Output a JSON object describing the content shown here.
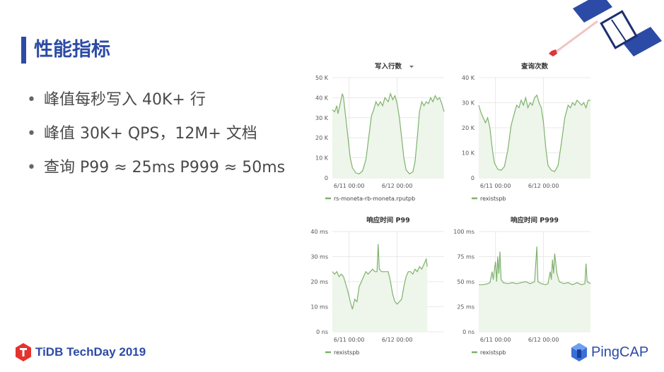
{
  "slide": {
    "title": "性能指标",
    "bullets": [
      "峰值每秒写入 40K+ 行",
      "峰值 30K+ QPS，12M+ 文档",
      "查询 P99 ≈ 25ms P999 ≈ 50ms"
    ],
    "footer_left": "TiDB TechDay 2019",
    "footer_right": "PingCAP"
  },
  "colors": {
    "accent": "#2c4ba6",
    "line": "#7eb26d",
    "fill": "#eef5ea",
    "text": "#4a4a4a",
    "footer_red": "#e5322d"
  },
  "chart_data": [
    {
      "type": "line",
      "title": "写入行数",
      "title_dropdown": true,
      "yticks": [
        "0",
        "10 K",
        "20 K",
        "30 K",
        "40 K",
        "50 K"
      ],
      "ylim": [
        0,
        50000
      ],
      "xticks": [
        "6/11 00:00",
        "6/12 00:00"
      ],
      "xtick_positions": [
        0.15,
        0.58
      ],
      "grid": true,
      "legend_placement": "bottom-left",
      "series": [
        {
          "name": "rs-moneta-rb-moneta.rputpb",
          "points": [
            [
              0,
              34000
            ],
            [
              0.02,
              33000
            ],
            [
              0.04,
              36000
            ],
            [
              0.05,
              32000
            ],
            [
              0.07,
              37000
            ],
            [
              0.09,
              42000
            ],
            [
              0.1,
              40000
            ],
            [
              0.12,
              30000
            ],
            [
              0.14,
              20000
            ],
            [
              0.16,
              10000
            ],
            [
              0.18,
              5000
            ],
            [
              0.21,
              2500
            ],
            [
              0.24,
              2000
            ],
            [
              0.27,
              3500
            ],
            [
              0.3,
              9000
            ],
            [
              0.33,
              22000
            ],
            [
              0.35,
              31000
            ],
            [
              0.37,
              34000
            ],
            [
              0.39,
              38000
            ],
            [
              0.41,
              36000
            ],
            [
              0.43,
              38000
            ],
            [
              0.45,
              36000
            ],
            [
              0.47,
              40000
            ],
            [
              0.5,
              38000
            ],
            [
              0.52,
              42000
            ],
            [
              0.54,
              39000
            ],
            [
              0.56,
              41000
            ],
            [
              0.58,
              37000
            ],
            [
              0.6,
              30000
            ],
            [
              0.62,
              20000
            ],
            [
              0.64,
              10000
            ],
            [
              0.66,
              4000
            ],
            [
              0.69,
              2000
            ],
            [
              0.72,
              3000
            ],
            [
              0.74,
              8000
            ],
            [
              0.76,
              20000
            ],
            [
              0.78,
              33000
            ],
            [
              0.8,
              38000
            ],
            [
              0.82,
              36000
            ],
            [
              0.84,
              38000
            ],
            [
              0.86,
              37000
            ],
            [
              0.88,
              40000
            ],
            [
              0.9,
              38000
            ],
            [
              0.92,
              41000
            ],
            [
              0.94,
              39000
            ],
            [
              0.96,
              40000
            ],
            [
              0.98,
              37000
            ],
            [
              1,
              33000
            ]
          ]
        }
      ]
    },
    {
      "type": "line",
      "title": "查询次数",
      "yticks": [
        "0",
        "10 K",
        "20 K",
        "30 K",
        "40 K"
      ],
      "ylim": [
        0,
        40000
      ],
      "xticks": [
        "6/11 00:00",
        "6/12 00:00"
      ],
      "xtick_positions": [
        0.15,
        0.58
      ],
      "grid": true,
      "legend_placement": "bottom-left",
      "series": [
        {
          "name": "rexistspb",
          "points": [
            [
              0,
              29000
            ],
            [
              0.02,
              26000
            ],
            [
              0.04,
              24000
            ],
            [
              0.06,
              22000
            ],
            [
              0.08,
              24000
            ],
            [
              0.1,
              20000
            ],
            [
              0.12,
              12000
            ],
            [
              0.14,
              6000
            ],
            [
              0.17,
              3500
            ],
            [
              0.2,
              3000
            ],
            [
              0.23,
              4500
            ],
            [
              0.26,
              11000
            ],
            [
              0.29,
              21000
            ],
            [
              0.32,
              26000
            ],
            [
              0.34,
              29000
            ],
            [
              0.36,
              28000
            ],
            [
              0.38,
              31000
            ],
            [
              0.4,
              29000
            ],
            [
              0.42,
              32000
            ],
            [
              0.44,
              28000
            ],
            [
              0.46,
              30000
            ],
            [
              0.48,
              29000
            ],
            [
              0.5,
              32000
            ],
            [
              0.52,
              33000
            ],
            [
              0.54,
              30000
            ],
            [
              0.56,
              28000
            ],
            [
              0.58,
              22000
            ],
            [
              0.6,
              12000
            ],
            [
              0.62,
              5000
            ],
            [
              0.65,
              3000
            ],
            [
              0.68,
              2500
            ],
            [
              0.71,
              5000
            ],
            [
              0.74,
              14000
            ],
            [
              0.77,
              24000
            ],
            [
              0.8,
              29000
            ],
            [
              0.82,
              28000
            ],
            [
              0.84,
              30000
            ],
            [
              0.86,
              29000
            ],
            [
              0.88,
              31000
            ],
            [
              0.9,
              30000
            ],
            [
              0.92,
              29000
            ],
            [
              0.94,
              30000
            ],
            [
              0.96,
              28000
            ],
            [
              0.98,
              31000
            ],
            [
              1,
              31000
            ]
          ]
        }
      ]
    },
    {
      "type": "line",
      "title": "响应时间 P99",
      "yticks": [
        "0 ns",
        "10 ms",
        "20 ms",
        "30 ms",
        "40 ms"
      ],
      "ylim": [
        0,
        40
      ],
      "xticks": [
        "6/11 00:00",
        "6/12 00:00"
      ],
      "xtick_positions": [
        0.15,
        0.58
      ],
      "grid": true,
      "legend_placement": "bottom-left",
      "series": [
        {
          "name": "rexistspb",
          "points": [
            [
              0,
              24000
            ],
            [
              0.02,
              23000
            ],
            [
              0.04,
              24000
            ],
            [
              0.06,
              22000
            ],
            [
              0.08,
              23000
            ],
            [
              0.1,
              22000
            ],
            [
              0.12,
              19000
            ],
            [
              0.14,
              16000
            ],
            [
              0.16,
              12000
            ],
            [
              0.18,
              9000
            ],
            [
              0.2,
              13000
            ],
            [
              0.22,
              12000
            ],
            [
              0.24,
              18000
            ],
            [
              0.26,
              20000
            ],
            [
              0.28,
              22000
            ],
            [
              0.3,
              24000
            ],
            [
              0.32,
              23000
            ],
            [
              0.34,
              24000
            ],
            [
              0.36,
              25000
            ],
            [
              0.38,
              24000
            ],
            [
              0.4,
              24000
            ],
            [
              0.41,
              35000
            ],
            [
              0.42,
              25000
            ],
            [
              0.44,
              24000
            ],
            [
              0.46,
              24000
            ],
            [
              0.48,
              24000
            ],
            [
              0.5,
              24000
            ],
            [
              0.52,
              20000
            ],
            [
              0.54,
              15000
            ],
            [
              0.56,
              12000
            ],
            [
              0.58,
              11000
            ],
            [
              0.6,
              12000
            ],
            [
              0.62,
              13000
            ],
            [
              0.64,
              18000
            ],
            [
              0.66,
              22000
            ],
            [
              0.68,
              24000
            ],
            [
              0.7,
              24000
            ],
            [
              0.72,
              23000
            ],
            [
              0.74,
              25000
            ],
            [
              0.76,
              24000
            ],
            [
              0.78,
              26000
            ],
            [
              0.8,
              25000
            ],
            [
              0.82,
              27000
            ],
            [
              0.84,
              29000
            ],
            [
              0.85,
              26000
            ]
          ]
        }
      ]
    },
    {
      "type": "line",
      "title": "响应时间 P999",
      "yticks": [
        "0 ns",
        "25 ms",
        "50 ms",
        "75 ms",
        "100 ms"
      ],
      "ylim": [
        0,
        100
      ],
      "xticks": [
        "6/11 00:00",
        "6/12 00:00"
      ],
      "xtick_positions": [
        0.15,
        0.58
      ],
      "grid": true,
      "legend_placement": "bottom-left",
      "series": [
        {
          "name": "rexistspb",
          "points": [
            [
              0,
              47000
            ],
            [
              0.04,
              47000
            ],
            [
              0.08,
              48000
            ],
            [
              0.1,
              49000
            ],
            [
              0.12,
              60000
            ],
            [
              0.13,
              52000
            ],
            [
              0.15,
              70000
            ],
            [
              0.16,
              50000
            ],
            [
              0.17,
              75000
            ],
            [
              0.18,
              58000
            ],
            [
              0.19,
              80000
            ],
            [
              0.2,
              52000
            ],
            [
              0.22,
              49000
            ],
            [
              0.26,
              48000
            ],
            [
              0.3,
              49000
            ],
            [
              0.34,
              48000
            ],
            [
              0.38,
              49000
            ],
            [
              0.42,
              50000
            ],
            [
              0.46,
              48000
            ],
            [
              0.5,
              50000
            ],
            [
              0.52,
              85000
            ],
            [
              0.53,
              50000
            ],
            [
              0.56,
              48000
            ],
            [
              0.6,
              47000
            ],
            [
              0.62,
              48000
            ],
            [
              0.64,
              60000
            ],
            [
              0.65,
              52000
            ],
            [
              0.66,
              72000
            ],
            [
              0.67,
              58000
            ],
            [
              0.68,
              78000
            ],
            [
              0.7,
              58000
            ],
            [
              0.72,
              50000
            ],
            [
              0.76,
              48000
            ],
            [
              0.8,
              49000
            ],
            [
              0.84,
              47000
            ],
            [
              0.88,
              49000
            ],
            [
              0.92,
              47000
            ],
            [
              0.95,
              48000
            ],
            [
              0.96,
              68000
            ],
            [
              0.97,
              50000
            ],
            [
              1,
              48000
            ]
          ]
        }
      ]
    }
  ]
}
